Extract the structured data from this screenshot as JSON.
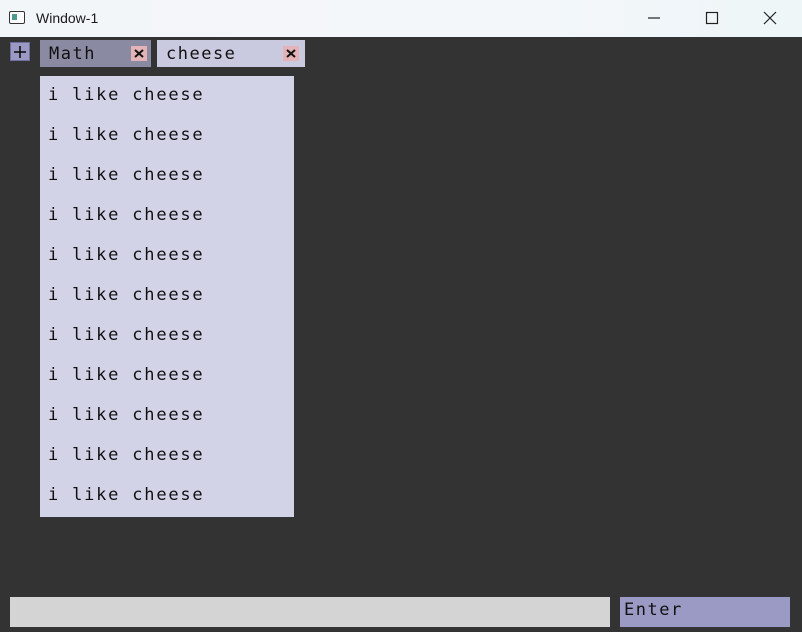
{
  "window": {
    "title": "Window-1"
  },
  "tabs": [
    {
      "label": "Math",
      "active": true
    },
    {
      "label": "cheese",
      "active": false
    }
  ],
  "list": {
    "items": [
      "i like cheese",
      "i like cheese",
      "i like cheese",
      "i like cheese",
      "i like cheese",
      "i like cheese",
      "i like cheese",
      "i like cheese",
      "i like cheese",
      "i like cheese",
      "i like cheese"
    ]
  },
  "input": {
    "value": "",
    "placeholder": ""
  },
  "enter_button": {
    "label": "Enter"
  },
  "colors": {
    "background": "#333333",
    "tab_active": "#8a8aa3",
    "tab_inactive": "#c9c9e0",
    "tab_close": "#e4b3b8",
    "list_bg": "#d3d3e8",
    "button_bg": "#9a9ac4",
    "input_bg": "#d4d4d4"
  },
  "icons": {
    "app": "window-app-icon",
    "minimize": "minimize-icon",
    "maximize": "maximize-icon",
    "close": "close-icon",
    "new_tab": "plus-icon",
    "tab_close": "x-icon"
  }
}
